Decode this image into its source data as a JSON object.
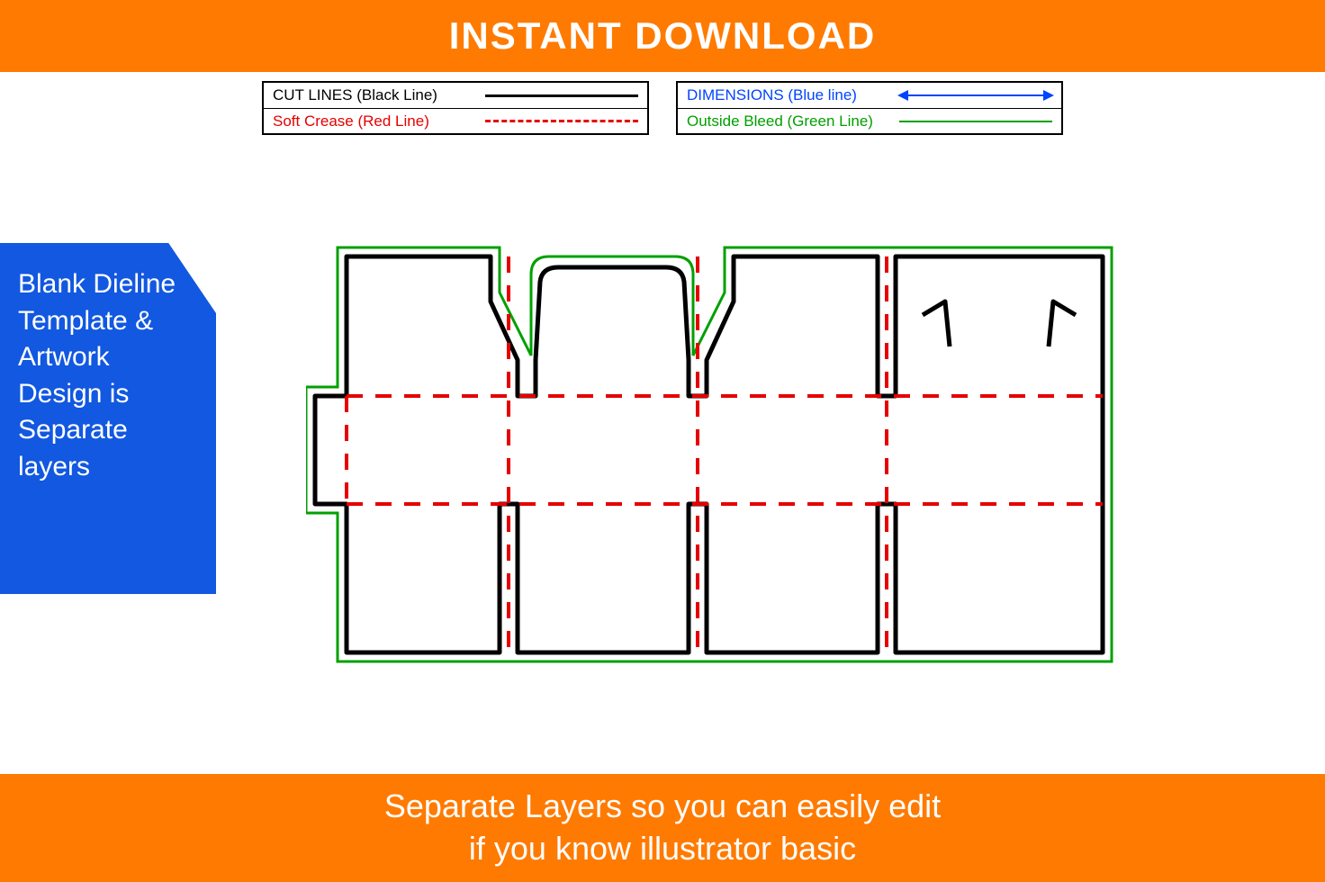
{
  "header": {
    "title": "INSTANT DOWNLOAD"
  },
  "legend": {
    "left": [
      {
        "label": "CUT LINES (Black Line)",
        "kind": "black-solid"
      },
      {
        "label": "Soft Crease (Red Line)",
        "kind": "red-dash"
      }
    ],
    "right": [
      {
        "label": "DIMENSIONS (Blue line)",
        "kind": "blue-arrow"
      },
      {
        "label": "Outside Bleed (Green Line)",
        "kind": "green-solid"
      }
    ]
  },
  "callout": {
    "text": "Blank Dieline Template & Artwork Design is Separate layers"
  },
  "footer": {
    "line1": "Separate Layers so you can easily edit",
    "line2": "if you know illustrator basic"
  },
  "colors": {
    "orange": "#ff7a00",
    "blue": "#1258e0",
    "cut": "#000000",
    "crease": "#e60000",
    "bleed": "#00a000",
    "dimension": "#0044ff"
  },
  "diagram": {
    "box_type": "packaging-dieline-flat-layout",
    "layers": [
      "outside-bleed",
      "cut-lines",
      "soft-crease"
    ],
    "description": "Four-panel wrap box dieline with glue tab on left, tuck flap above second panel, handle cutouts on rightmost panel, two horizontal fold lines across all panels and three vertical fold lines between panels."
  }
}
